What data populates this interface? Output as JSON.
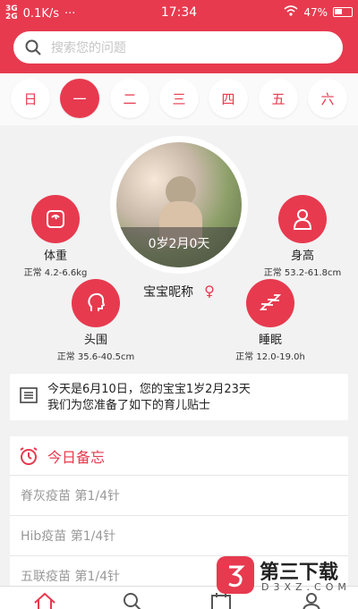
{
  "status": {
    "signal_top": "3G",
    "signal_bottom": "2G",
    "speed": "0.1K/s",
    "time": "17:34",
    "battery": "47%"
  },
  "search": {
    "placeholder": "搜索您的问题"
  },
  "week": {
    "days": [
      "日",
      "一",
      "二",
      "三",
      "四",
      "五",
      "六"
    ],
    "active_index": 1
  },
  "baby": {
    "age": "0岁2月0天",
    "nickname": "宝宝昵称",
    "gender_icon": "♀"
  },
  "metrics": {
    "weight": {
      "name": "体重",
      "range": "正常 4.2-6.6kg"
    },
    "height": {
      "name": "身高",
      "range": "正常 53.2-61.8cm"
    },
    "head": {
      "name": "头围",
      "range": "正常 35.6-40.5cm"
    },
    "sleep": {
      "name": "睡眠",
      "range": "正常 12.0-19.0h"
    }
  },
  "tip": {
    "line1": "今天是6月10日，您的宝宝1岁2月23天",
    "line2": "我们为您准备了如下的育儿贴士"
  },
  "memo": {
    "title": "今日备忘",
    "items": [
      "脊灰疫苗 第1/4针",
      "Hib疫苗 第1/4针",
      "五联疫苗 第1/4针"
    ]
  },
  "watermark": {
    "name": "第三下载",
    "url": "D3XZ.COM"
  },
  "colors": {
    "accent": "#e73a4f"
  },
  "icons": [
    "search-icon",
    "scale-icon",
    "person-icon",
    "head-icon",
    "sleep-zzz-icon",
    "list-icon",
    "alarm-clock-icon",
    "home-icon",
    "search-tab-icon",
    "calendar-tab-icon",
    "profile-tab-icon"
  ]
}
